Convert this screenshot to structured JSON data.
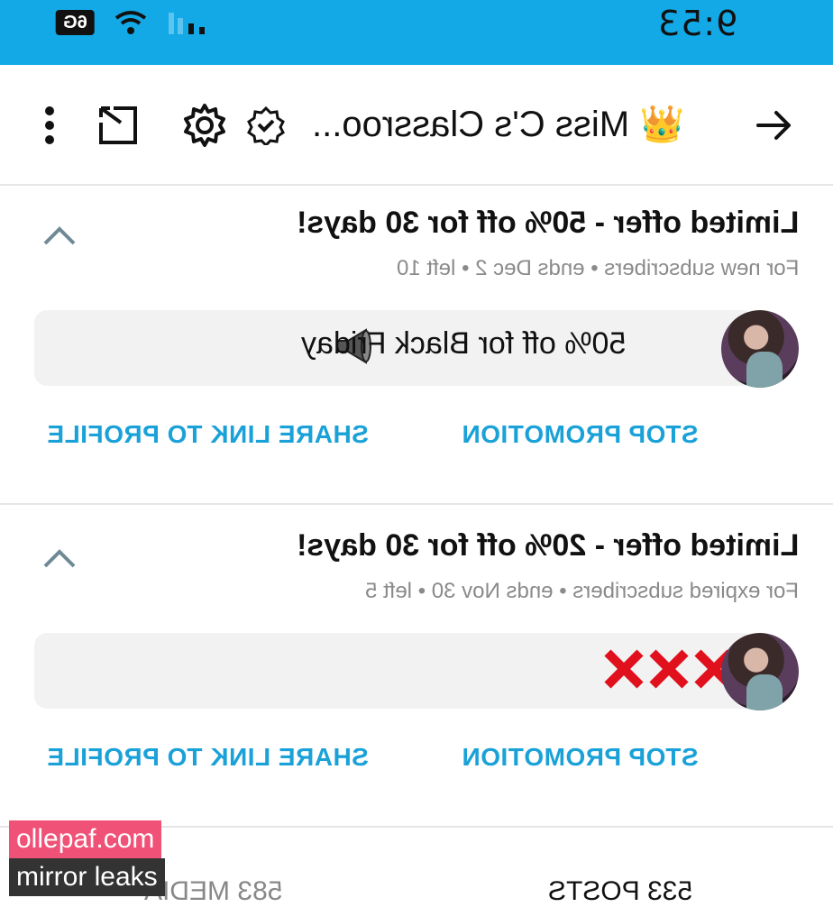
{
  "status_bar": {
    "time": "9:53",
    "network_badge": "6G"
  },
  "header": {
    "title": "👑 Miss C's Classroo...",
    "icons": [
      "arrow-right-icon",
      "verified-badge-icon",
      "gear-icon",
      "share-icon",
      "more-vert-icon"
    ]
  },
  "promotions": [
    {
      "title": "Limited offer - 50% off for 30 days!",
      "subtitle": "For new subscribers  •  ends Dec 2  •  left 10",
      "message": "50% off for Black Friday",
      "stop_label": "STOP PROMOTION",
      "share_label": "SHARE LINK TO PROFILE"
    },
    {
      "title": "Limited offer - 20% off for 30 days!",
      "subtitle": "For expired subscribers  •  ends Nov 30  •  left 5",
      "message": "XXX",
      "stop_label": "STOP PROMOTION",
      "share_label": "SHARE LINK TO PROFILE"
    }
  ],
  "stats": {
    "posts": "533 POSTS",
    "media": "583 MEDIA"
  },
  "watermark": {
    "line1": "ollepaf.com",
    "line2": "mirror leaks",
    "colors": {
      "line1_bg": "#f05177",
      "line2_bg": "#333333"
    }
  },
  "colors": {
    "status_bar": "#12a9e6",
    "accent": "#1aa2d8"
  }
}
